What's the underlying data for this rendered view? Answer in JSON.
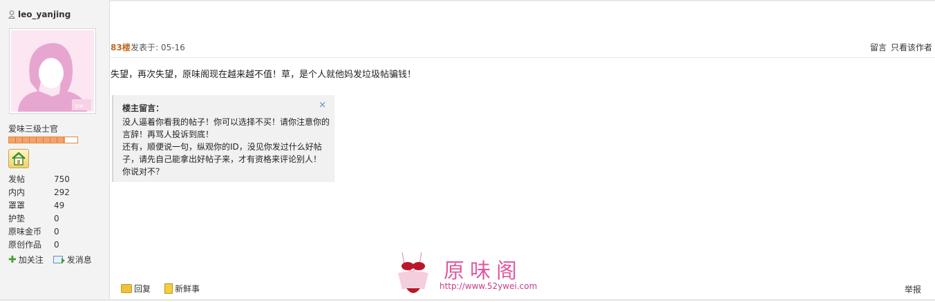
{
  "user": {
    "name": "leo_yanjing",
    "avatar_badge": "pw",
    "rank_title": "爱味三级士官",
    "rank_progress": 0.82,
    "stats": [
      {
        "label": "发帖",
        "value": "750"
      },
      {
        "label": "内内",
        "value": "292"
      },
      {
        "label": "罩罩",
        "value": "49"
      },
      {
        "label": "护垫",
        "value": "0"
      },
      {
        "label": "原味金币",
        "value": "0"
      },
      {
        "label": "原创作品",
        "value": "0"
      }
    ],
    "follow_label": "加关注",
    "message_label": "发消息"
  },
  "post": {
    "floor": "83楼",
    "posted_at": "发表于: 05-16",
    "comment_link": "留言",
    "only_author_link": "只看该作者",
    "content": "失望，再次失望，原味阁现在越来越不值！草，是个人就他妈发垃圾帖骗钱！",
    "owner_comment": {
      "title": "楼主留言：",
      "close": "×",
      "lines": [
        "没人逼着你看我的帖子！你可以选择不买！请你注意你的",
        "言辞！再骂人投诉到底！",
        "还有，顺便说一句，纵观你的ID，没见你发过什么好帖",
        "子，请先自己能拿出好帖子来，才有资格来评论别人！",
        "你说对不？"
      ]
    },
    "reply_label": "回复",
    "news_label": "新鲜事",
    "report_label": "举报"
  },
  "watermark": {
    "name": "原味阁",
    "url": "http://www.52ywei.com"
  },
  "colors": {
    "floor": "#c3691e",
    "watermark": "#e05aa0",
    "sidebar_bg": "#f3f3f3"
  }
}
